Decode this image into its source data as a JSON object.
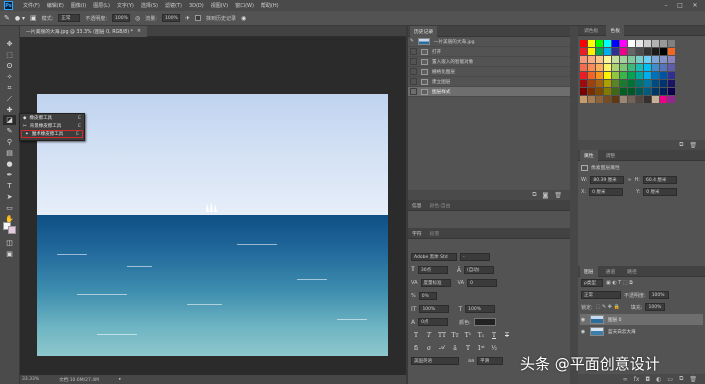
{
  "menubar": {
    "logo": "Ps",
    "items": [
      "文件(F)",
      "编辑(E)",
      "图像(I)",
      "图层(L)",
      "文字(Y)",
      "选择(S)",
      "滤镜(T)",
      "3D(D)",
      "视图(V)",
      "窗口(W)",
      "帮助(H)"
    ],
    "win_min": "–",
    "win_max": "□",
    "win_close": "✕"
  },
  "options": {
    "mode_label": "模式:",
    "mode_value": "正常",
    "opacity_label": "不透明度:",
    "opacity_value": "100%",
    "flow_label": "流量:",
    "flow_value": "100%",
    "erase_history_label": "抹到历史记录"
  },
  "document": {
    "tab_title": "一片美丽的大海.jpg @ 33.3% (图层 0, RGB/8) *",
    "tab_close": "×"
  },
  "tool_flyout": {
    "items": [
      {
        "label": "橡皮擦工具",
        "key": "E"
      },
      {
        "label": "背景橡皮擦工具",
        "key": "E"
      },
      {
        "label": "魔术橡皮擦工具",
        "key": "E"
      }
    ]
  },
  "status": {
    "zoom": "33.33%",
    "doc": "文档:10.6M/27.4M"
  },
  "history": {
    "tabs": [
      "历史记录"
    ],
    "snapshot": "一片美丽的大海.jpg",
    "states": [
      "打开",
      "置入嵌入的智能对象",
      "栅格化图层",
      "建立图层",
      "图层样式"
    ],
    "selected_index": 4
  },
  "mini_panels": {
    "row1": [
      "信息",
      "颜色:自由"
    ],
    "row2": [
      "字符",
      "段落"
    ]
  },
  "character": {
    "font_family": "Adobe 黑体 Std",
    "font_style": "-",
    "font_size": "30点",
    "leading": "(自动)",
    "kerning": "度量标准",
    "tracking": "0",
    "vscale": "100%",
    "hscale": "100%",
    "baseline": "0点",
    "color_label": "颜色:",
    "lang": "美国英语",
    "aa_label": "aa",
    "aa_value": "平滑"
  },
  "swatches": {
    "tabs": [
      "调色板",
      "色板"
    ],
    "colors": [
      "#ff0000",
      "#ffff00",
      "#00ff00",
      "#00ffff",
      "#0000ff",
      "#ff00ff",
      "#ffffff",
      "#e6e6e6",
      "#cccccc",
      "#b3b3b3",
      "#999999",
      "#808080",
      "#ed1c24",
      "#fff200",
      "#00a651",
      "#00aeef",
      "#2e3192",
      "#ec008c",
      "#666666",
      "#4d4d4d",
      "#333333",
      "#1a1a1a",
      "#000000",
      "#f26522",
      "#f7977a",
      "#f9ad81",
      "#fdc68a",
      "#fff79a",
      "#c4df9b",
      "#a3d39c",
      "#82ca9d",
      "#7bcdc8",
      "#6ecff6",
      "#7ea7d8",
      "#8493ca",
      "#8882be",
      "#f26c4f",
      "#f68e55",
      "#fbaf5c",
      "#fff467",
      "#acd372",
      "#7cc576",
      "#3bb878",
      "#1abbb4",
      "#00bff3",
      "#438ccb",
      "#5574b9",
      "#605ca8",
      "#ed1c24",
      "#f26522",
      "#f7941d",
      "#fff200",
      "#8dc73f",
      "#39b54a",
      "#00a651",
      "#00a99d",
      "#00aeef",
      "#0072bc",
      "#0054a6",
      "#2e3192",
      "#9e0b0f",
      "#a0410d",
      "#a36209",
      "#aba000",
      "#598527",
      "#1a7b30",
      "#007236",
      "#00746b",
      "#0076a3",
      "#004b80",
      "#003471",
      "#1b1464",
      "#790000",
      "#7b2e00",
      "#7d4900",
      "#827b00",
      "#406618",
      "#005e20",
      "#005826",
      "#005952",
      "#005b7f",
      "#003663",
      "#002157",
      "#0d004c",
      "#c69c6d",
      "#a67c52",
      "#8c6239",
      "#754c24",
      "#603913",
      "#998675",
      "#736357",
      "#534741",
      "#362f2d",
      "#c7b299",
      "#ec008c",
      "#92278f"
    ]
  },
  "properties": {
    "tabs": [
      "属性",
      "调整"
    ],
    "title": "像素图层属性",
    "w_label": "W:",
    "w_value": "80.39 厘米",
    "h_label": "H:",
    "h_value": "60.4 厘米",
    "x_label": "X:",
    "x_value": "0 厘米",
    "y_label": "Y:",
    "y_value": "0 厘米"
  },
  "layers": {
    "tabs": [
      "图层",
      "通道",
      "路径"
    ],
    "filter_label": "ρ类型",
    "blend_mode": "正常",
    "opacity_label": "不透明度:",
    "opacity_value": "100%",
    "lock_label": "锁定:",
    "fill_label": "填充:",
    "fill_value": "100%",
    "items": [
      {
        "name": "图层 0",
        "selected": true
      },
      {
        "name": "蓝天白云大海",
        "selected": false
      }
    ]
  },
  "watermark": "头条 @平面创意设计"
}
